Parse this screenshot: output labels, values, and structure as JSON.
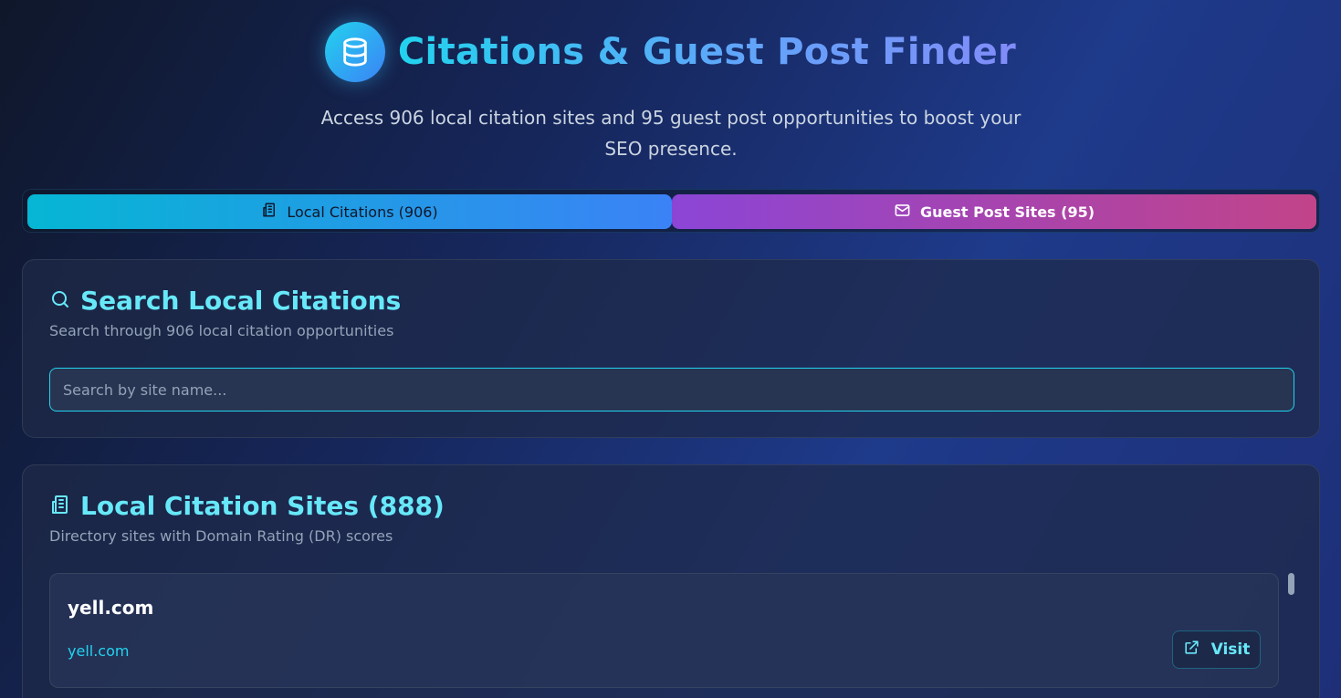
{
  "header": {
    "logo_icon": "database-icon",
    "title": "Citations & Guest Post Finder",
    "subtitle": "Access 906 local citation sites and 95 guest post opportunities to boost your SEO presence."
  },
  "tabs": [
    {
      "label": "Local Citations (906)",
      "icon": "building-icon",
      "active": true
    },
    {
      "label": "Guest Post Sites (95)",
      "icon": "mail-icon",
      "active": false
    }
  ],
  "search_card": {
    "icon": "search-icon",
    "title": "Search Local Citations",
    "description": "Search through 906 local citation opportunities",
    "placeholder": "Search by site name...",
    "value": ""
  },
  "sites_card": {
    "icon": "building-icon",
    "title": "Local Citation Sites (888)",
    "description": "Directory sites with Domain Rating (DR) scores",
    "items": [
      {
        "name": "yell.com",
        "link": "yell.com",
        "button_label": "Visit",
        "button_icon": "external-link-icon"
      }
    ]
  },
  "colors": {
    "accent_cyan": "#22d3ee",
    "accent_blue": "#3b82f6",
    "accent_purple": "#8b45d6",
    "accent_pink": "#c24489"
  }
}
